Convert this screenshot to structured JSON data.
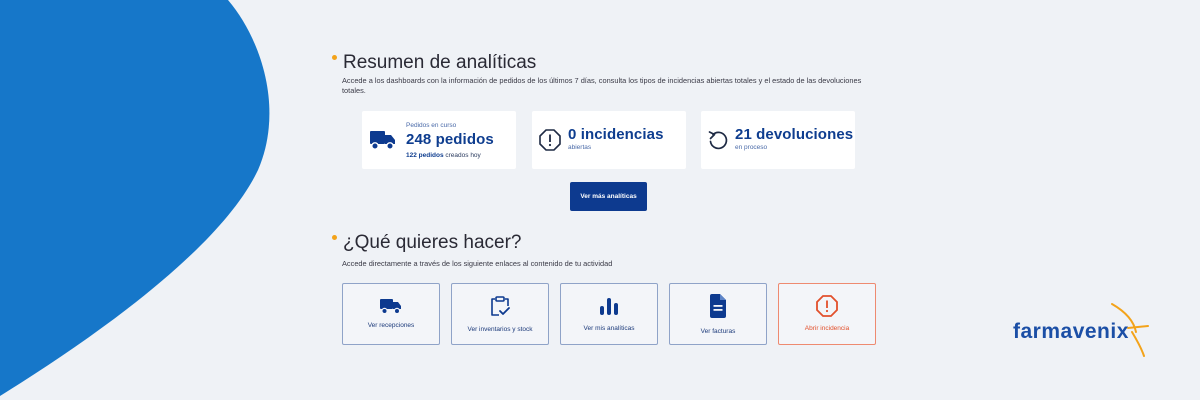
{
  "colors": {
    "brand_blue": "#0d3a8f",
    "bg_blue": "#1677c9",
    "accent_orange": "#f3a31a",
    "alert_red": "#e2502c"
  },
  "analytics": {
    "title": "Resumen de analíticas",
    "description": "Accede a los dashboards con la información de pedidos de los últimos 7 días, consulta los tipos de incidencias abiertas totales y el estado de las devoluciones totales.",
    "cards": {
      "orders": {
        "icon": "truck-icon",
        "label": "Pedidos en curso",
        "value": "248 pedidos",
        "sub_value": "122 pedidos",
        "sub_text": "creados hoy"
      },
      "incidents": {
        "icon": "alert-octagon-icon",
        "value": "0 incidencias",
        "sub_text": "abiertas"
      },
      "returns": {
        "icon": "return-arrow-icon",
        "value": "21 devoluciones",
        "sub_text": "en proceso"
      }
    },
    "button_label": "Ver más analíticas"
  },
  "actions": {
    "title": "¿Qué quieres hacer?",
    "description": "Accede directamente a través de los siguiente enlaces al contenido de tu actividad",
    "items": [
      {
        "icon": "truck-icon",
        "label": "Ver recepciones"
      },
      {
        "icon": "clipboard-check-icon",
        "label": "Ver inventarios y stock"
      },
      {
        "icon": "bar-chart-icon",
        "label": "Ver mis analíticas"
      },
      {
        "icon": "document-icon",
        "label": "Ver facturas"
      },
      {
        "icon": "alert-octagon-icon",
        "label": "Abrir incidencia"
      }
    ]
  },
  "logo": {
    "text": "farmavenix"
  }
}
